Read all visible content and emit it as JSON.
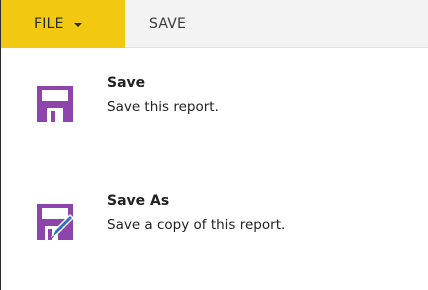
{
  "ribbon": {
    "file_tab_label": "FILE",
    "save_tab_label": "SAVE",
    "accent_color": "#f2c811"
  },
  "menu": {
    "items": [
      {
        "title": "Save",
        "description": "Save this report.",
        "icon": "floppy-disk-icon",
        "icon_color": "#8e44ad"
      },
      {
        "title": "Save As",
        "description": "Save a copy of this report.",
        "icon": "floppy-disk-pencil-icon",
        "icon_color": "#8e44ad"
      }
    ]
  }
}
